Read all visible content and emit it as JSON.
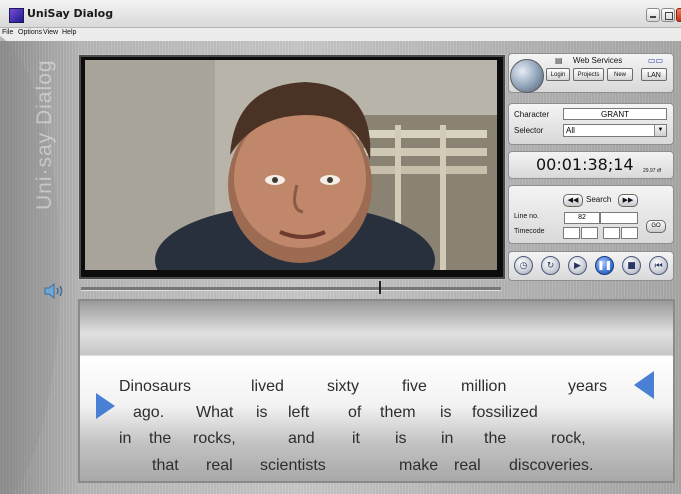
{
  "window": {
    "title": "UniSay Dialog"
  },
  "menu": [
    "File",
    "Options",
    "View",
    "Help"
  ],
  "brand": {
    "vertical_text": "Uni·say  Dialog"
  },
  "web_services": {
    "label": "Web Services",
    "buttons": {
      "login": "Login",
      "projects": "Projects",
      "new": "New",
      "lan": "LAN"
    }
  },
  "character": {
    "label": "Character",
    "value": "GRANT"
  },
  "selector": {
    "label": "Selector",
    "value": "All"
  },
  "timecode": {
    "value": "00:01:38;14",
    "fps": "29.97 df"
  },
  "search": {
    "label": "Search",
    "line_no_label": "Line no.",
    "line_no_value": "82",
    "timecode_label": "Timecode",
    "go_label": "GO"
  },
  "transport": [
    "clock",
    "loop",
    "play",
    "pause",
    "stop",
    "rewind"
  ],
  "playhead": {
    "position_fraction": 0.71
  },
  "script": {
    "lines": [
      [
        "Dinosaurs",
        "lived",
        "sixty",
        "five",
        "million",
        "years"
      ],
      [
        "ago.",
        "What",
        "is",
        "left",
        "of",
        "them",
        "is",
        "fossilized"
      ],
      [
        "in",
        "the",
        "rocks,",
        "and",
        "it",
        "is",
        "in",
        "the",
        "rock,"
      ],
      [
        "that",
        "real",
        "scientists",
        "make",
        "real",
        "discoveries."
      ]
    ]
  },
  "colors": {
    "accent_blue": "#4a7fd6",
    "window_bg": "#c9c9c9"
  }
}
